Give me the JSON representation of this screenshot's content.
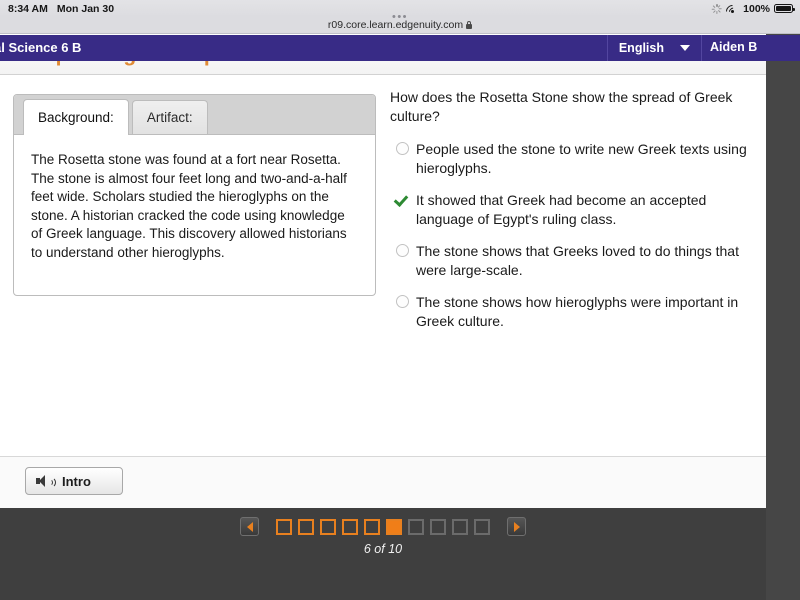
{
  "status_bar": {
    "time": "8:34 AM",
    "date": "Mon Jan 30",
    "battery_percent": "100%",
    "icons": [
      "spinner-icon",
      "wifi-icon",
      "battery-icon"
    ]
  },
  "browser": {
    "url": "r09.core.learn.edgenuity.com",
    "tab_dots": "•••",
    "lock": "lock-icon"
  },
  "course_bar": {
    "course_title": "al Science 6 B",
    "language": "English",
    "user": "Aiden B",
    "chevron": "chevron-down-icon"
  },
  "lesson": {
    "heading": "Explaining the Importance of the Rosetta Stone"
  },
  "tab_panel": {
    "tabs": [
      {
        "label": "Background:",
        "active": true
      },
      {
        "label": "Artifact:",
        "active": false
      }
    ],
    "body": "The Rosetta stone was found at a fort near Rosetta. The stone is almost four feet long and two-and-a-half feet wide. Scholars studied the hieroglyphs on the stone. A historian cracked the code using knowledge of Greek language. This discovery allowed historians to understand other hieroglyphs."
  },
  "question": {
    "prompt": "How does the Rosetta Stone show the spread of Greek culture?",
    "options": [
      {
        "text": "People used the stone to write new Greek texts using hieroglyphs.",
        "selected": false
      },
      {
        "text": "It showed that Greek had become an accepted language of Egypt's ruling class.",
        "selected": true
      },
      {
        "text": "The stone shows that Greeks loved to do things that were large-scale.",
        "selected": false
      },
      {
        "text": "The stone shows how hieroglyphs were important in Greek culture.",
        "selected": false
      }
    ]
  },
  "toolbar": {
    "intro_label": "Intro",
    "speaker": "speaker-icon"
  },
  "pagination": {
    "prev_label": "◀",
    "next_label": "▶",
    "count_text": "6 of 10",
    "current": 6,
    "total": 10,
    "states": [
      "visited",
      "visited",
      "visited",
      "visited",
      "visited",
      "current",
      "future",
      "future",
      "future",
      "future"
    ]
  },
  "colors": {
    "purple_bar": "#382b86",
    "orange_heading": "#e08b35",
    "orange_accent": "#e8801f",
    "check_green": "#2d8a33",
    "footer_dark": "#3f3f3f",
    "right_rail": "#464646"
  }
}
